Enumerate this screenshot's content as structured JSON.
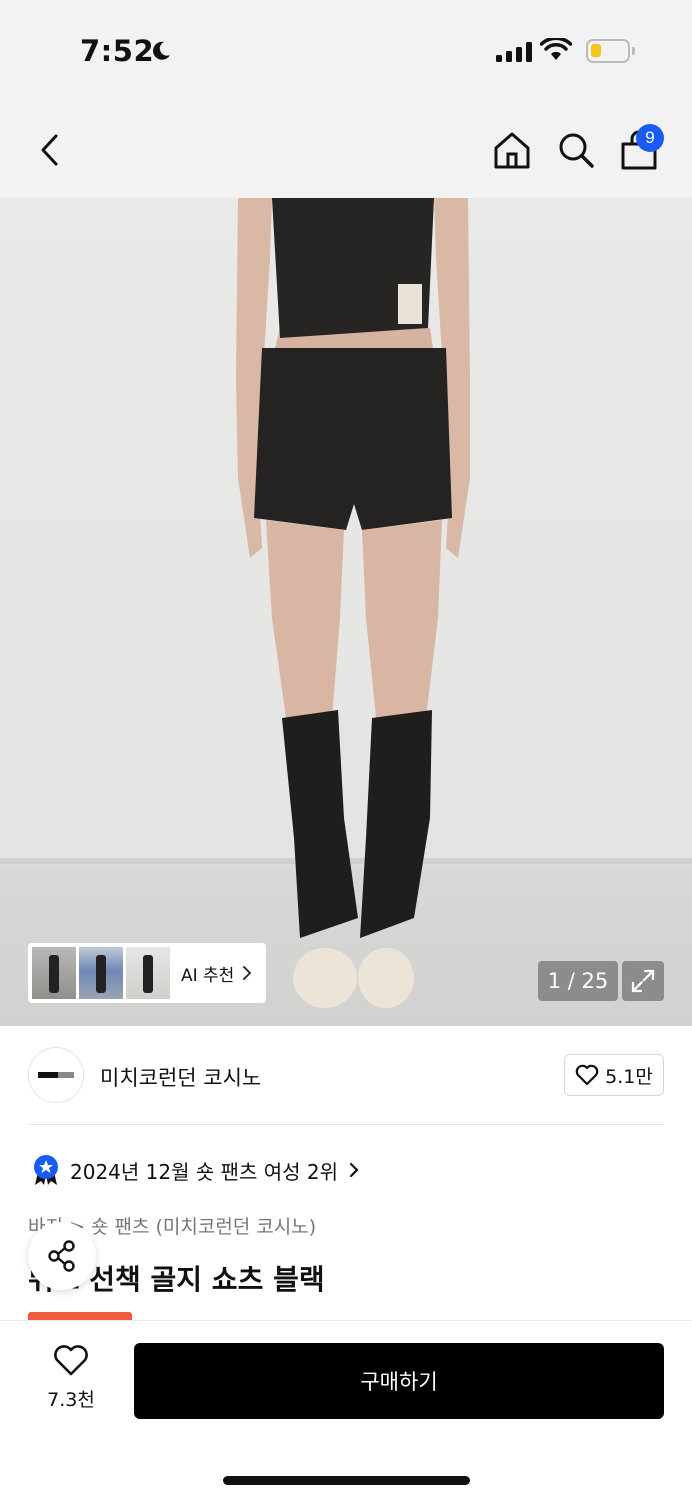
{
  "status_bar": {
    "time": "7:52"
  },
  "header": {
    "cart_badge": "9"
  },
  "gallery": {
    "ai_recommend_label": "AI 추천",
    "counter": "1 / 25"
  },
  "brand": {
    "name": "미치코런던 코시노",
    "like_count": "5.1만"
  },
  "ranking": {
    "text": "2024년 12월 숏 팬츠 여성 2위"
  },
  "breadcrumb": {
    "text": "바지 > 숏 팬츠 (미치코런던 코시노)"
  },
  "product": {
    "title": "뷔스 선책 골지 쇼츠 블랙"
  },
  "bottom_bar": {
    "wish_count": "7.3천",
    "buy_label": "구매하기"
  },
  "colors": {
    "accent": "#1a5cf2",
    "buy_button": "#000000",
    "sale_badge": "#f25a3c"
  }
}
